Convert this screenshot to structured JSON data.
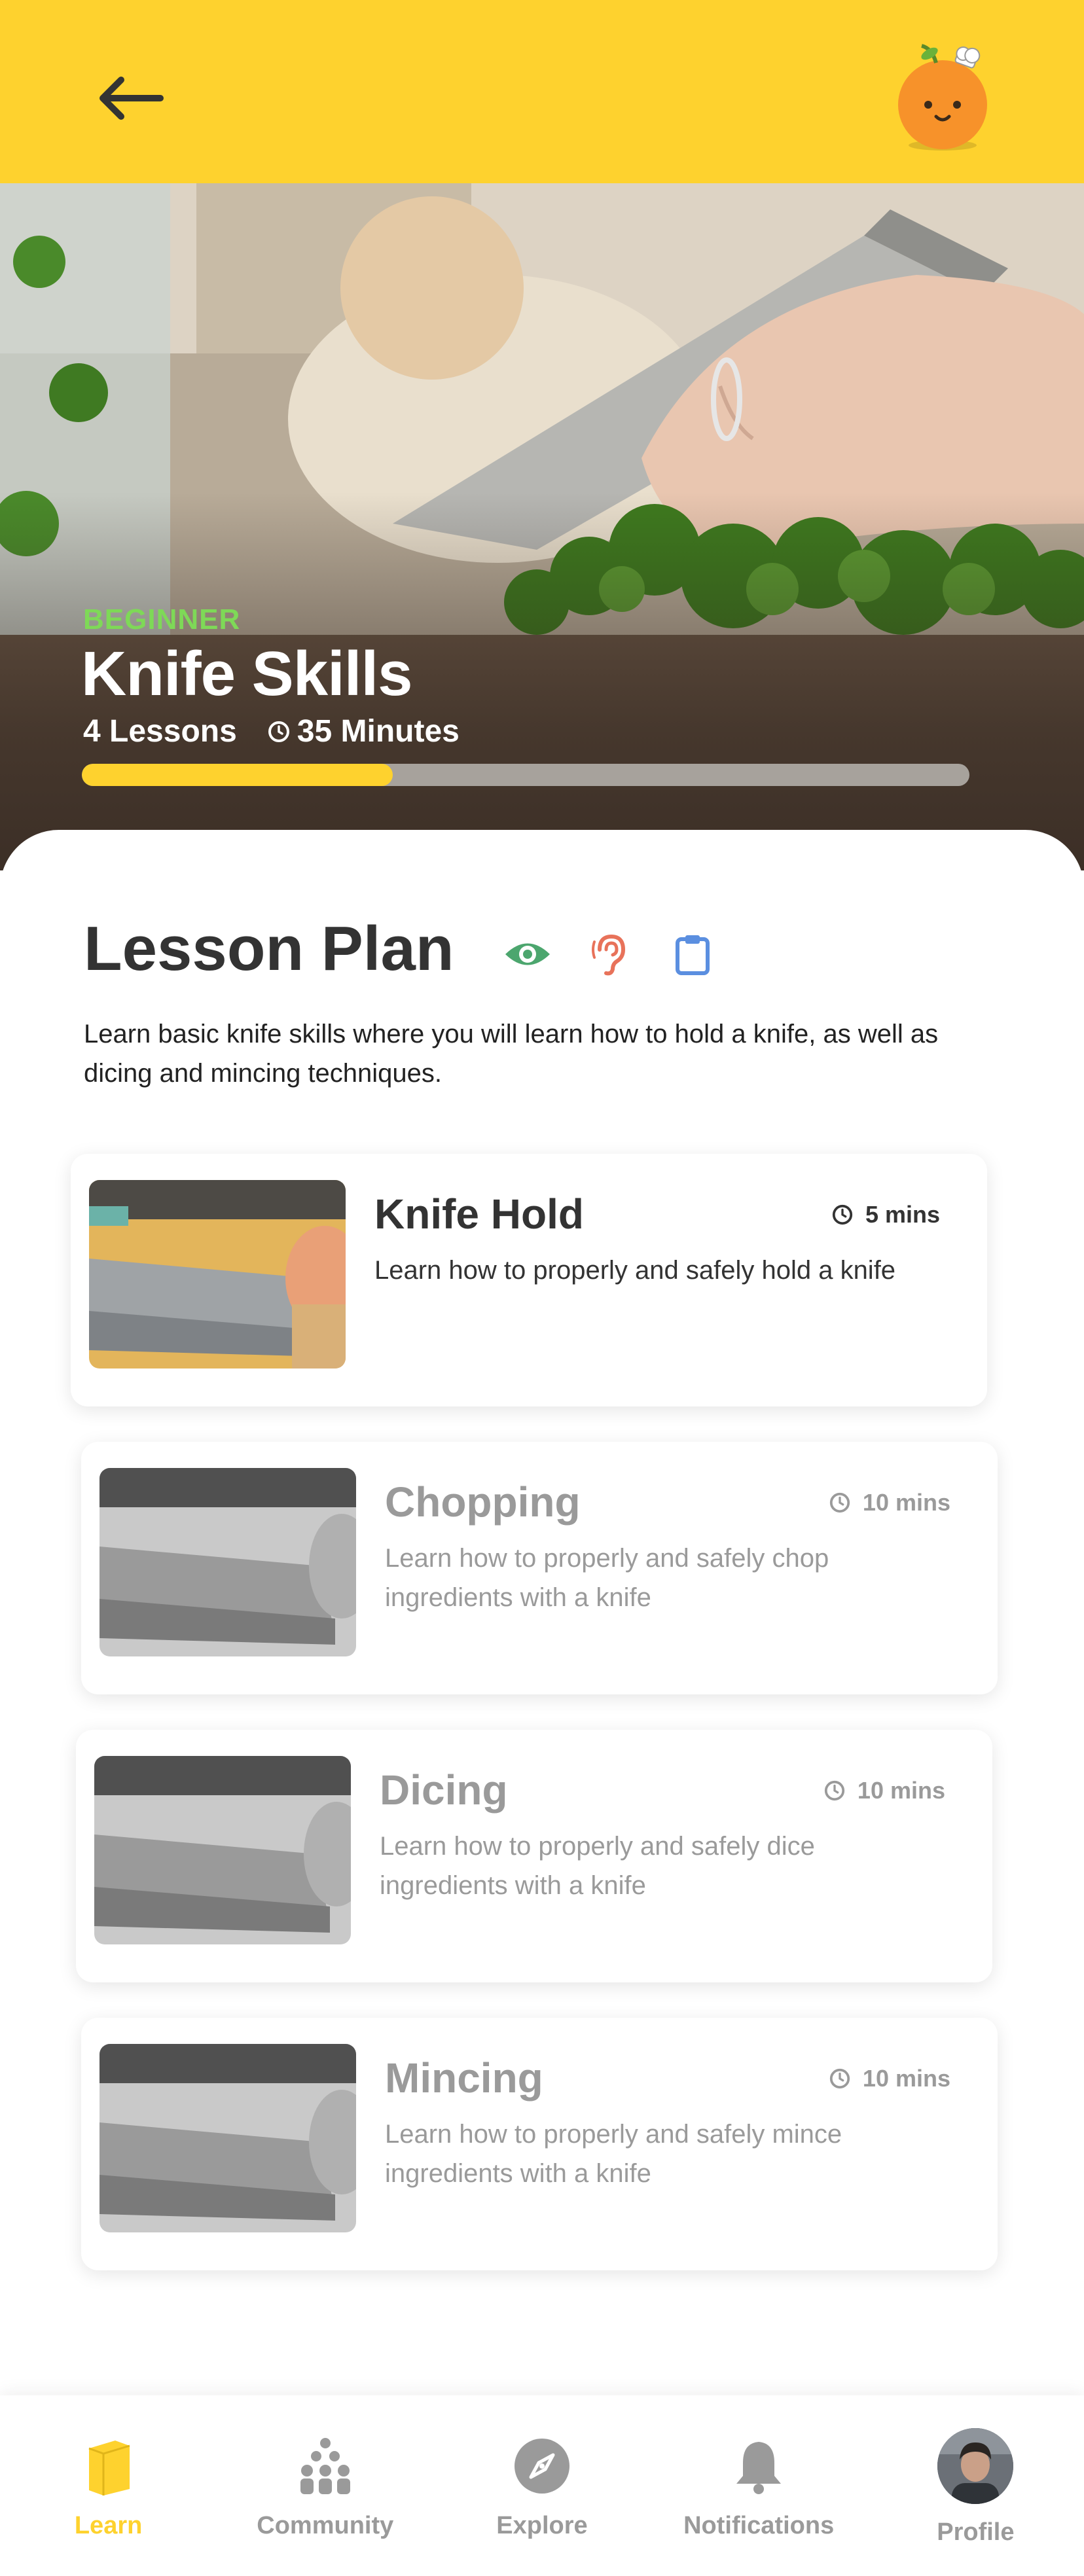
{
  "header": {
    "back_icon": "arrow-left-icon",
    "mascot_icon": "orange-chef-mascot-icon",
    "background": "#FED22E"
  },
  "course": {
    "level": "BEGINNER",
    "title": "Knife Skills",
    "lessons": "4 Lessons",
    "duration": "35 Minutes",
    "progress": 0.35,
    "level_color": "#7ED957"
  },
  "lesson_plan": {
    "title": "Lesson Plan",
    "icons": [
      "eye-icon",
      "ear-icon",
      "clipboard-icon"
    ],
    "description": "Learn basic knife skills where you will learn  how to hold a knife, as well as dicing and mincing techniques."
  },
  "lessons": [
    {
      "title": "Knife Hold",
      "description": "Learn how to properly and safely hold a knife",
      "duration": "5 mins",
      "active": true
    },
    {
      "title": "Chopping",
      "description": "Learn how to properly and safely chop ingredients with a knife",
      "duration": "10 mins",
      "active": false
    },
    {
      "title": "Dicing",
      "description": "Learn how to properly and safely dice ingredients with a knife",
      "duration": "10 mins",
      "active": false
    },
    {
      "title": "Mincing",
      "description": "Learn how to properly and safely mince ingredients with a knife",
      "duration": "10 mins",
      "active": false
    }
  ],
  "nav": [
    {
      "label": "Learn",
      "icon": "book-icon",
      "active": true
    },
    {
      "label": "Community",
      "icon": "people-icon",
      "active": false
    },
    {
      "label": "Explore",
      "icon": "compass-icon",
      "active": false
    },
    {
      "label": "Notifications",
      "icon": "bell-icon",
      "active": false
    },
    {
      "label": "Profile",
      "icon": "avatar",
      "active": false
    }
  ],
  "colors": {
    "accent": "#FED22E",
    "eye": "#4CA66E",
    "ear": "#E8725A",
    "clipboard": "#5B8FE0",
    "muted": "#9a9a9a"
  }
}
